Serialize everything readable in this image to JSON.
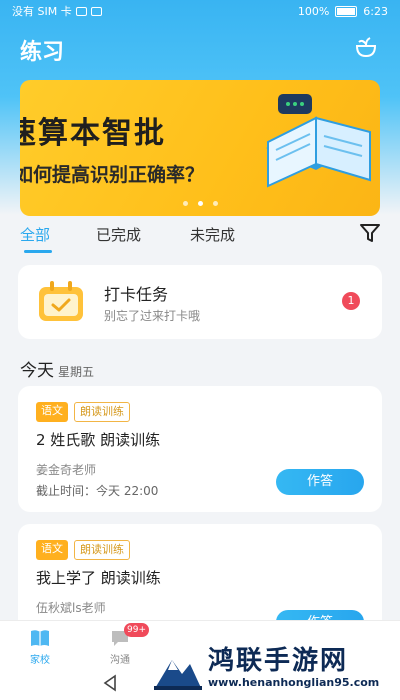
{
  "status_bar": {
    "carrier": "没有 SIM 卡",
    "battery_percent": "100%",
    "time": "6:23"
  },
  "header": {
    "title": "练习"
  },
  "banner": {
    "headline": "速算本智批",
    "subline": "如何提高识别正确率？",
    "active_dot": 1,
    "dot_count": 3
  },
  "tabs": [
    {
      "label": "全部",
      "active": true
    },
    {
      "label": "已完成",
      "active": false
    },
    {
      "label": "未完成",
      "active": false
    }
  ],
  "checkin": {
    "title": "打卡任务",
    "subtitle": "别忘了过来打卡哦",
    "badge": "1"
  },
  "day_group": {
    "label": "今天",
    "weekday": "星期五"
  },
  "tasks": [
    {
      "subject": "语文",
      "type": "朗读训练",
      "name": "2 姓氏歌 朗读训练",
      "teacher": "姜金奇老师",
      "deadline": "截止时间：今天 22:00",
      "button": "作答"
    },
    {
      "subject": "语文",
      "type": "朗读训练",
      "name": "我上学了 朗读训练",
      "teacher": "伍秋斌ls老师",
      "button": "作答"
    }
  ],
  "bottom_nav": [
    {
      "label": "家校",
      "icon": "book-icon",
      "active": true
    },
    {
      "label": "沟通",
      "icon": "chat-icon",
      "badge": "99+",
      "active": false
    }
  ],
  "watermark": {
    "text": "鸿联手游网",
    "url": "www.henanhonglian95.com"
  },
  "colors": {
    "accent": "#2aa8ee",
    "header": "#39b4f2",
    "banner": "#ffc21f",
    "tag": "#ffb01f",
    "badge": "#f04a5a"
  }
}
